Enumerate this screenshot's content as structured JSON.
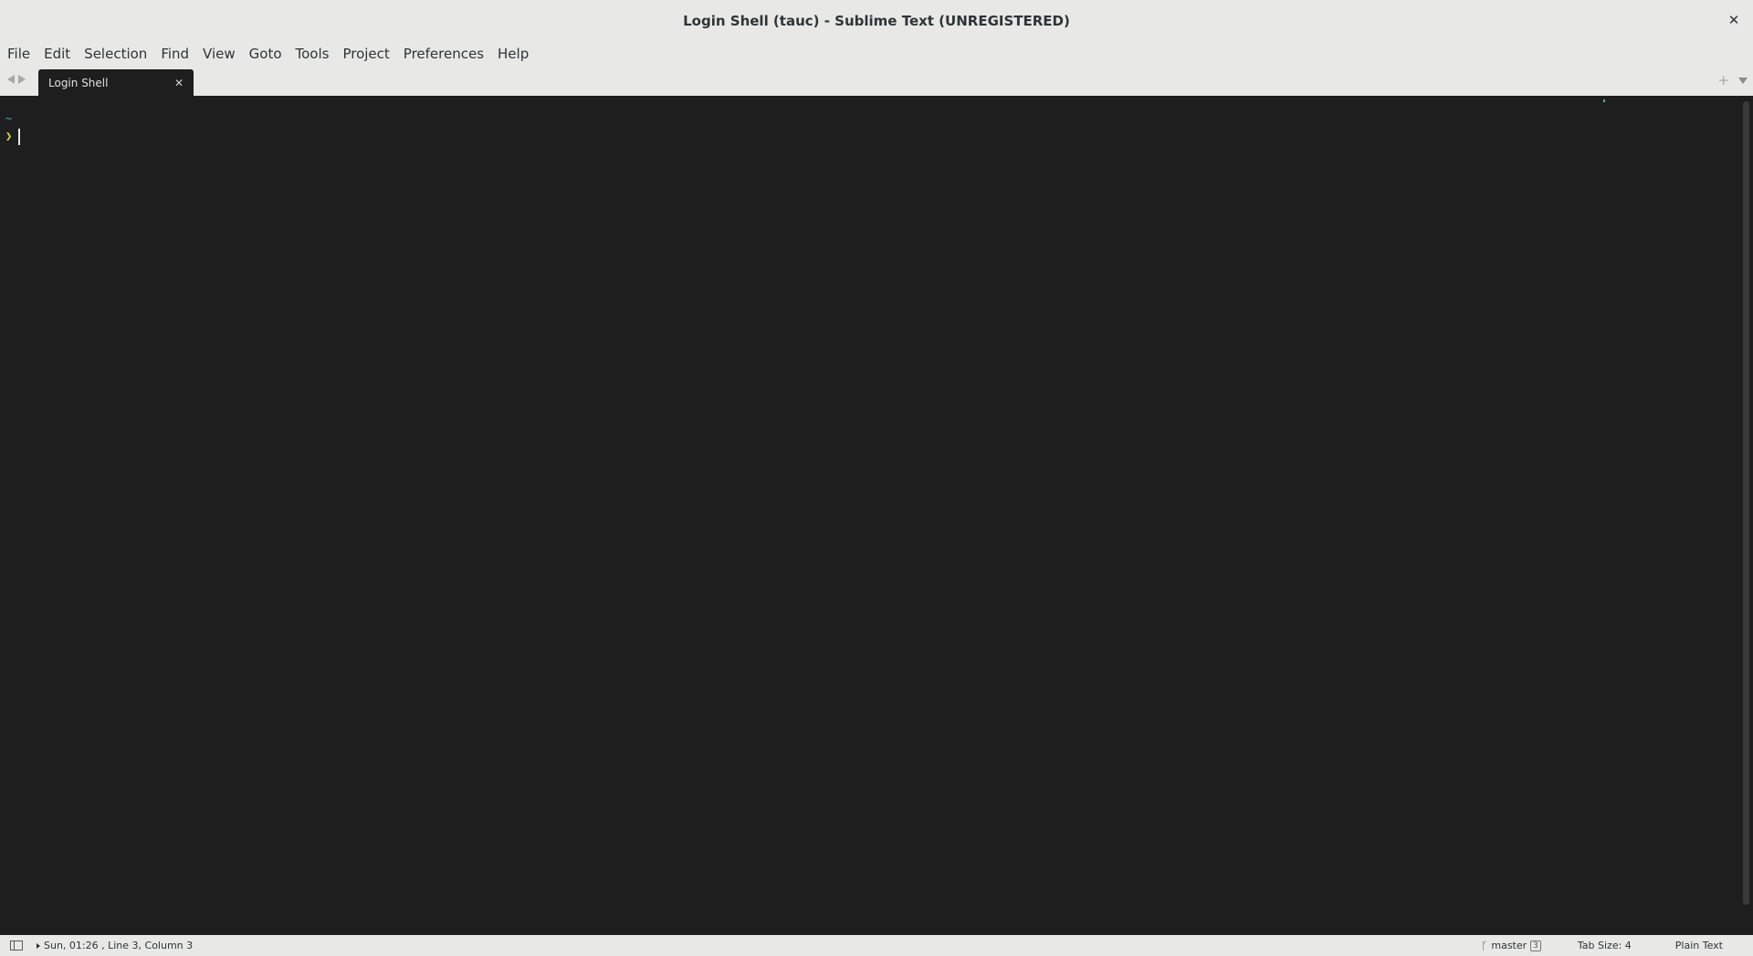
{
  "window": {
    "title": "Login Shell (tauc) - Sublime Text (UNREGISTERED)",
    "close_glyph": "✕"
  },
  "menu": {
    "items": [
      "File",
      "Edit",
      "Selection",
      "Find",
      "View",
      "Goto",
      "Tools",
      "Project",
      "Preferences",
      "Help"
    ]
  },
  "tabs": [
    {
      "label": "Login Shell",
      "close_glyph": "✕",
      "active": true
    }
  ],
  "tabbar": {
    "new_tab_glyph": "+"
  },
  "editor": {
    "lines": [
      "~",
      "❯"
    ],
    "colors": {
      "background": "#1e1e1e",
      "tilde": "#4db6ac",
      "prompt": "#e6e150"
    }
  },
  "statusbar": {
    "position_text": "Sun, 01:26 , Line 3, Column 3",
    "git_branch": "master",
    "git_badge": "3",
    "tab_size": "Tab Size: 4",
    "syntax": "Plain Text"
  },
  "icons": {
    "close": "close-icon",
    "nav_back": "chevron-left-icon",
    "nav_forward": "chevron-right-icon",
    "new_tab": "plus-icon",
    "tab_dropdown": "chevron-down-icon",
    "sidebar_toggle": "sidebar-icon",
    "branch": "git-branch-icon"
  }
}
